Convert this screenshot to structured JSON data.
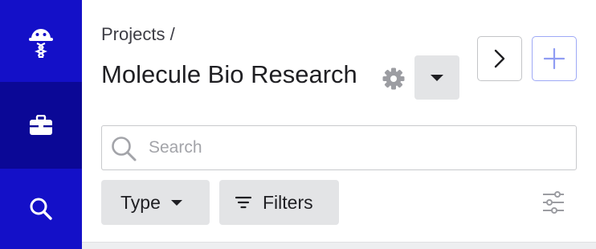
{
  "nav": {
    "items": [
      {
        "id": "logo",
        "icon": "astronaut-dna-logo-icon"
      },
      {
        "id": "projects",
        "icon": "briefcase-icon",
        "active": true
      },
      {
        "id": "search",
        "icon": "search-icon"
      }
    ]
  },
  "header": {
    "breadcrumb": "Projects /",
    "title": "Molecule Bio Research",
    "settings_icon": "gear-icon",
    "dropdown_icon": "caret-down-icon",
    "next_icon": "chevron-right-icon",
    "add_icon": "plus-icon"
  },
  "search": {
    "placeholder": "Search",
    "value": ""
  },
  "filters": {
    "type_label": "Type",
    "filters_label": "Filters",
    "view_options_icon": "sliders-icon"
  },
  "colors": {
    "rail": "#1410c8",
    "rail_active": "#0b0896",
    "chip_bg": "#e3e4e6",
    "accent_border": "#9ea9f6"
  }
}
